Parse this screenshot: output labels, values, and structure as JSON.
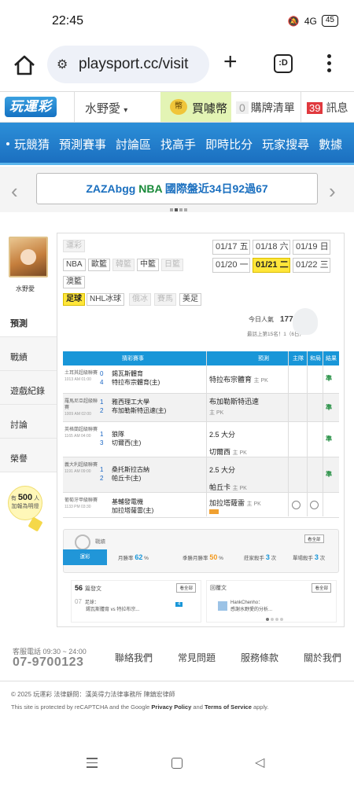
{
  "status": {
    "time": "22:45",
    "battery": "45",
    "signal": "4G"
  },
  "browser": {
    "url": "playsport.cc/visit",
    "tab_count": ":D"
  },
  "topbar": {
    "logo": "玩運彩",
    "username": "水野愛",
    "buy_coin": "買噱幣",
    "cart_count": "0",
    "cart_label": "購牌清單",
    "msg_count": "39",
    "msg_label": "訊息"
  },
  "nav": {
    "items": [
      "玩競猜",
      "預測賽事",
      "討論區",
      "找高手",
      "即時比分",
      "玩家搜尋",
      "數據"
    ]
  },
  "banner": {
    "prefix": "ZAZAbgg ",
    "league": "NBA",
    "text": " 國際盤近34日92過67"
  },
  "profile": {
    "name": "水野愛"
  },
  "sidebar": {
    "items": [
      "預測",
      "戰績",
      "遊戲紀錄",
      "討論",
      "榮譽"
    ],
    "bulb_prefix": "有",
    "bulb_count": "500",
    "bulb_unit": "人",
    "bulb_line2": "加報為明燈"
  },
  "leagues": {
    "row1": [
      "運彩",
      "NBA",
      "歐籃",
      "韓籃",
      "中籃",
      "日籃",
      "澳籃"
    ],
    "row2": [
      "足球",
      "NHL冰球",
      "俄冰",
      "賽馬",
      "美足"
    ]
  },
  "dates": [
    {
      "label": "01/17 五"
    },
    {
      "label": "01/18 六"
    },
    {
      "label": "01/19 日"
    },
    {
      "label": "01/20 一"
    },
    {
      "label": "01/21 二"
    },
    {
      "label": "01/22 三"
    }
  ],
  "visitors": {
    "label": "今日人氣",
    "count": "177",
    "rank": "最話上第15名！1（6日）"
  },
  "table": {
    "headers": {
      "match": "猜彩賽事",
      "pred": "預測",
      "home": "主隊",
      "draw": "和局",
      "result": "結果"
    },
    "rows": [
      {
        "league": "土耳其超級聯賽",
        "time": "1013 AM 01:00",
        "n1": "0",
        "n2": "4",
        "t1": "錫瓦斯體育",
        "t2": "特拉布宗體育(主)",
        "p1": "特拉布宗體育",
        "p1tag": "主 PK",
        "p2": "",
        "p2tag": "",
        "res": "準"
      },
      {
        "league": "羅馬尼亞超級聯賽",
        "time": "1009 AM 02:00",
        "n1": "1",
        "n2": "2",
        "t1": "雅西理工大學",
        "t2": "布加勒斯特迅速(主)",
        "p1": "布加勒斯特迅速",
        "p1tag": "主 PK",
        "p2": "",
        "p2tag": "",
        "res": "準"
      },
      {
        "league": "英格蘭超級聯賽",
        "time": "1165 AM 04:00",
        "n1": "1",
        "n2": "3",
        "t1": "狼隊",
        "t2": "切爾西(主)",
        "p1": "2.5 大分",
        "p1tag": "",
        "p2": "切爾西",
        "p2tag": "主 PK",
        "res": "準"
      },
      {
        "league": "義大利超級聯賽",
        "time": "1191 AM 09:00",
        "n1": "1",
        "n2": "2",
        "t1": "桑托斯拉古納",
        "t2": "帕丘卡(主)",
        "p1": "2.5 大分",
        "p1tag": "",
        "p2": "帕丘卡",
        "p2tag": "主 PK",
        "res": "準"
      },
      {
        "league": "葡萄牙甲級聯賽",
        "time": "1133 PM 03:30",
        "n1": "",
        "n2": "",
        "t1": "基輔發電機",
        "t2": "加拉塔薩雷(主)",
        "p1": "加拉塔薩雷",
        "p1tag": "主 PK",
        "p2": "",
        "p2tag": "",
        "res": ""
      }
    ]
  },
  "stats": {
    "title": "戰績",
    "more": "看全部",
    "tab": "運彩",
    "items": [
      {
        "label": "月勝率",
        "value": "62",
        "unit": "%"
      },
      {
        "label": "季勝月勝率",
        "value": "50",
        "unit": "%"
      },
      {
        "label": "莊家殺手",
        "value": "3",
        "unit": "次"
      },
      {
        "label": "單場殺手",
        "value": "3",
        "unit": "次"
      }
    ]
  },
  "cards": {
    "left": {
      "count": "56",
      "title": "篇發文",
      "more": "看全部",
      "date": "07",
      "text1": "足球：",
      "text2": "錫瓦斯體育 vs 特拉布宗...",
      "badge": "4"
    },
    "right": {
      "title": "回覆文",
      "more": "看全部",
      "author": "HankChenho：",
      "text": "感謝水野愛的分析..."
    }
  },
  "footer": {
    "service": "客服電話 09:30 ~ 24:00",
    "phone": "07-9700123",
    "links": [
      "聯絡我們",
      "常見問題",
      "服務條款",
      "關於我們"
    ],
    "copyright": "© 2025 玩運彩 法律顧問：漢英得力法律事務所 陳鎮宏律師",
    "recap_pre": "This site is protected by reCAPTCHA and the Google ",
    "privacy": "Privacy Policy",
    "and": " and ",
    "terms": "Terms of Service",
    "apply": " apply."
  },
  "colors": {
    "nav_blue": "#1b6fc0",
    "accent_yellow": "#ffe63a",
    "win_green": "#1a8a3a"
  }
}
